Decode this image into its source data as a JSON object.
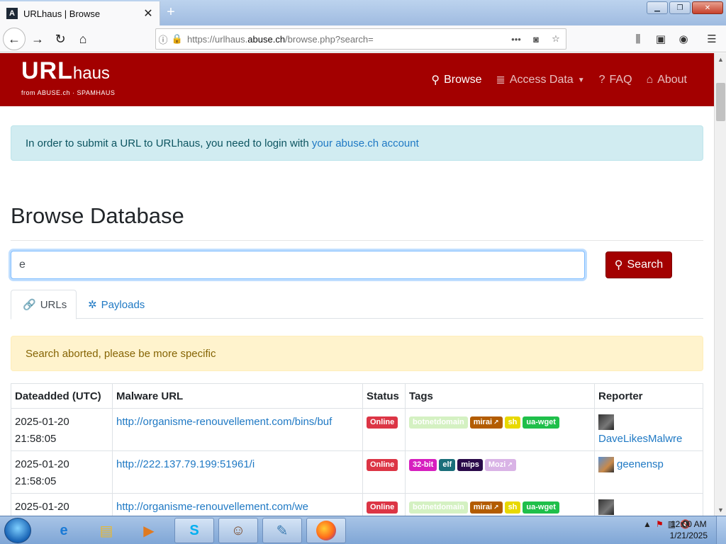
{
  "browser": {
    "tab_title": "URLhaus | Browse",
    "new_tab_symbol": "+",
    "url_prefix": "https://urlhaus.",
    "url_domain": "abuse.ch",
    "url_suffix": "/browse.php?search="
  },
  "site": {
    "logo_main": "URL",
    "logo_sub": "haus",
    "logo_from": "from ABUSE.ch  ·  SPAMHAUS",
    "nav": [
      {
        "label": "Browse"
      },
      {
        "label": "Access Data"
      },
      {
        "label": "FAQ"
      },
      {
        "label": "About"
      }
    ]
  },
  "info_text": "In order to submit a URL to URLhaus, you need to login with ",
  "info_link": "your abuse.ch account",
  "page_title": "Browse Database",
  "search": {
    "value": "e",
    "button_label": "Search"
  },
  "tabs": [
    {
      "label": "URLs"
    },
    {
      "label": "Payloads"
    }
  ],
  "warning_text": "Search aborted, please be more specific",
  "table": {
    "headers": [
      "Dateadded (UTC)",
      "Malware URL",
      "Status",
      "Tags",
      "Reporter"
    ],
    "rows": [
      {
        "date": "2025-01-20",
        "time": "21:58:05",
        "url": "http://organisme-renouvellement.com/bins/buf",
        "status": "Online",
        "tags": [
          {
            "label": "botnetdomain",
            "color": "#d4f1c2",
            "text_color": "#ffffff"
          },
          {
            "label": "mirai",
            "color": "#b35c00",
            "text_color": "#ffffff",
            "ext": true
          },
          {
            "label": "sh",
            "color": "#e8d800",
            "text_color": "#ffffff"
          },
          {
            "label": "ua-wget",
            "color": "#1fbf4a",
            "text_color": "#ffffff"
          }
        ],
        "reporter": "DaveLikesMalwre"
      },
      {
        "date": "2025-01-20",
        "time": "21:58:05",
        "url": "http://222.137.79.199:51961/i",
        "status": "Online",
        "tags": [
          {
            "label": "32-bit",
            "color": "#d61fbf",
            "text_color": "#ffffff"
          },
          {
            "label": "elf",
            "color": "#1a6e7a",
            "text_color": "#ffffff"
          },
          {
            "label": "mips",
            "color": "#2a0a4a",
            "text_color": "#ffffff"
          },
          {
            "label": "Mozi",
            "color": "#d9b3e6",
            "text_color": "#ffffff",
            "ext": true
          }
        ],
        "reporter": "geenensp"
      },
      {
        "date": "2025-01-20",
        "time": "",
        "url": "http://organisme-renouvellement.com/we",
        "status": "Online",
        "tags": [
          {
            "label": "botnetdomain",
            "color": "#d4f1c2",
            "text_color": "#ffffff"
          },
          {
            "label": "mirai",
            "color": "#b35c00",
            "text_color": "#ffffff",
            "ext": true
          },
          {
            "label": "sh",
            "color": "#e8d800",
            "text_color": "#ffffff"
          },
          {
            "label": "ua-wget",
            "color": "#1fbf4a",
            "text_color": "#ffffff"
          }
        ],
        "reporter": ""
      }
    ]
  },
  "taskbar": {
    "clock_time": "12:00 AM",
    "clock_date": "1/21/2025"
  },
  "colors": {
    "brand": "#a30000",
    "link": "#1f79c4",
    "online": "#dc3545"
  }
}
